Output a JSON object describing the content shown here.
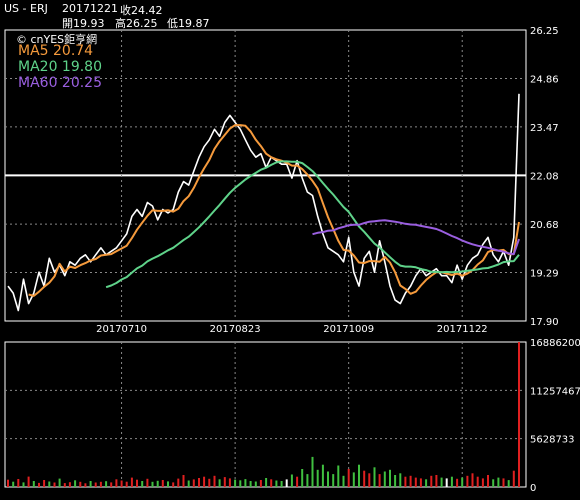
{
  "header": {
    "symbol": "US - ERJ",
    "date": "20171221",
    "close": "收24.42",
    "open": "開19.93",
    "high": "高26.25",
    "low": "低19.87"
  },
  "watermark": "© cnYES鉅亨網",
  "legend": [
    {
      "label": "MA5 20.74",
      "color": "#f59a3c"
    },
    {
      "label": "MA20 19.80",
      "color": "#5fd38a"
    },
    {
      "label": "MA60 20.25",
      "color": "#9a5fe0"
    }
  ],
  "colors": {
    "background": "#000000",
    "price": "#ffffff",
    "ma5": "#f59a3c",
    "ma20": "#5fd38a",
    "ma60": "#9a5fe0",
    "vol_up": "#e02020",
    "vol_down": "#40c040",
    "vol_flat": "#ffffff"
  },
  "chart_data": [
    {
      "type": "line",
      "x_ticks": [
        "20170710",
        "20170823",
        "20171009",
        "20171122"
      ],
      "y_ticks": [
        "26.25",
        "24.86",
        "23.47",
        "22.08",
        "20.68",
        "19.29",
        "17.90"
      ],
      "ylim": [
        17.9,
        26.25
      ],
      "reference_line": 22.08,
      "grid": true,
      "series": [
        {
          "name": "Price",
          "values": [
            18.9,
            18.7,
            18.2,
            19.1,
            18.4,
            18.7,
            19.3,
            18.9,
            19.7,
            19.3,
            19.5,
            19.2,
            19.6,
            19.5,
            19.7,
            19.8,
            19.6,
            19.8,
            20.0,
            19.8,
            19.9,
            20.0,
            20.2,
            20.4,
            20.9,
            21.1,
            20.9,
            21.3,
            21.2,
            20.8,
            21.1,
            21.0,
            21.1,
            21.6,
            21.9,
            21.8,
            22.2,
            22.6,
            22.9,
            23.1,
            23.4,
            23.2,
            23.6,
            23.8,
            23.6,
            23.4,
            23.1,
            22.8,
            22.6,
            22.7,
            22.3,
            22.6,
            22.5,
            22.4,
            22.4,
            22.0,
            22.5,
            22.0,
            21.6,
            21.5,
            20.9,
            20.4,
            20.0,
            19.9,
            19.8,
            19.6,
            20.3,
            19.3,
            18.9,
            19.7,
            19.9,
            19.3,
            20.2,
            19.6,
            18.9,
            18.5,
            18.4,
            18.7,
            18.9,
            19.2,
            19.4,
            19.2,
            19.3,
            19.4,
            19.2,
            19.2,
            19.0,
            19.5,
            19.1,
            19.5,
            19.7,
            19.8,
            20.1,
            20.3,
            19.8,
            19.6,
            19.9,
            19.5,
            20.3,
            24.42
          ]
        },
        {
          "name": "MA5",
          "values": [
            null,
            null,
            null,
            null,
            18.66,
            18.62,
            18.74,
            18.88,
            19.0,
            19.18,
            19.54,
            19.32,
            19.46,
            19.42,
            19.5,
            19.56,
            19.64,
            19.68,
            19.78,
            19.8,
            19.82,
            19.9,
            19.98,
            20.06,
            20.28,
            20.52,
            20.72,
            20.92,
            21.08,
            21.06,
            21.06,
            21.08,
            21.04,
            21.12,
            21.34,
            21.48,
            21.72,
            22.02,
            22.28,
            22.52,
            22.84,
            23.06,
            23.24,
            23.42,
            23.52,
            23.52,
            23.5,
            23.34,
            23.1,
            22.92,
            22.7,
            22.6,
            22.54,
            22.5,
            22.44,
            22.36,
            22.36,
            22.26,
            22.1,
            21.92,
            21.7,
            21.28,
            20.88,
            20.54,
            20.2,
            19.94,
            19.92,
            19.78,
            19.58,
            19.56,
            19.62,
            19.62,
            19.6,
            19.74,
            19.58,
            19.3,
            18.92,
            18.82,
            18.68,
            18.74,
            18.92,
            19.08,
            19.2,
            19.3,
            19.3,
            19.26,
            19.22,
            19.26,
            19.2,
            19.26,
            19.36,
            19.52,
            19.64,
            19.88,
            19.94,
            19.92,
            19.94,
            19.82,
            19.82,
            20.74
          ]
        },
        {
          "name": "MA20",
          "values": [
            null,
            null,
            null,
            null,
            null,
            null,
            null,
            null,
            null,
            null,
            null,
            null,
            null,
            null,
            null,
            null,
            null,
            null,
            null,
            18.87,
            18.92,
            18.99,
            19.09,
            19.16,
            19.29,
            19.41,
            19.49,
            19.61,
            19.69,
            19.76,
            19.84,
            19.93,
            20.0,
            20.11,
            20.22,
            20.32,
            20.45,
            20.59,
            20.74,
            20.9,
            21.07,
            21.23,
            21.41,
            21.58,
            21.72,
            21.84,
            21.96,
            22.06,
            22.15,
            22.24,
            22.3,
            22.38,
            22.45,
            22.48,
            22.48,
            22.47,
            22.47,
            22.43,
            22.32,
            22.2,
            22.04,
            21.86,
            21.69,
            21.53,
            21.35,
            21.17,
            21.03,
            20.82,
            20.61,
            20.46,
            20.29,
            20.12,
            20.01,
            19.87,
            19.73,
            19.6,
            19.49,
            19.46,
            19.46,
            19.44,
            19.39,
            19.36,
            19.31,
            19.31,
            19.3,
            19.31,
            19.3,
            19.31,
            19.32,
            19.34,
            19.36,
            19.38,
            19.41,
            19.42,
            19.47,
            19.52,
            19.59,
            19.61,
            19.62,
            19.8
          ]
        },
        {
          "name": "MA60",
          "values": [
            null,
            null,
            null,
            null,
            null,
            null,
            null,
            null,
            null,
            null,
            null,
            null,
            null,
            null,
            null,
            null,
            null,
            null,
            null,
            null,
            null,
            null,
            null,
            null,
            null,
            null,
            null,
            null,
            null,
            null,
            null,
            null,
            null,
            null,
            null,
            null,
            null,
            null,
            null,
            null,
            null,
            null,
            null,
            null,
            null,
            null,
            null,
            null,
            null,
            null,
            null,
            null,
            null,
            null,
            null,
            null,
            null,
            null,
            null,
            20.39,
            20.43,
            20.45,
            20.49,
            20.5,
            20.56,
            20.6,
            20.65,
            20.66,
            20.66,
            20.71,
            20.75,
            20.76,
            20.78,
            20.79,
            20.77,
            20.75,
            20.72,
            20.69,
            20.67,
            20.66,
            20.63,
            20.6,
            20.57,
            20.54,
            20.48,
            20.41,
            20.34,
            20.28,
            20.21,
            20.15,
            20.1,
            20.06,
            20.03,
            20.0,
            19.96,
            19.92,
            19.89,
            19.84,
            19.82,
            20.25
          ]
        }
      ]
    },
    {
      "type": "bar",
      "y_ticks": [
        "16886200",
        "11257467",
        "5628733",
        "0"
      ],
      "ylim": [
        0,
        16886200
      ],
      "values": [
        850000,
        620000,
        930000,
        540000,
        1210000,
        700000,
        480000,
        820000,
        640000,
        520000,
        980000,
        450000,
        560000,
        780000,
        600000,
        430000,
        700000,
        520000,
        610000,
        680000,
        540000,
        900000,
        760000,
        620000,
        1100000,
        850000,
        700000,
        950000,
        600000,
        720000,
        820000,
        650000,
        540000,
        980000,
        1400000,
        760000,
        880000,
        1050000,
        1200000,
        950000,
        1300000,
        900000,
        1150000,
        1000000,
        860000,
        780000,
        920000,
        700000,
        640000,
        820000,
        1050000,
        900000,
        760000,
        700000,
        880000,
        1450000,
        1200000,
        2100000,
        1500000,
        3500000,
        2000000,
        2600000,
        1800000,
        1500000,
        2500000,
        1300000,
        2100000,
        1700000,
        2600000,
        1900000,
        1600000,
        2300000,
        1500000,
        1800000,
        2000000,
        1400000,
        1600000,
        1200000,
        1300000,
        1100000,
        1000000,
        900000,
        1300000,
        1400000,
        1100000,
        1000000,
        1200000,
        950000,
        1100000,
        1300000,
        1600000,
        1200000,
        1000000,
        1400000,
        900000,
        1100000,
        1000000,
        800000,
        1900000,
        16886200
      ],
      "direction": [
        "u",
        "d",
        "u",
        "d",
        "u",
        "d",
        "u",
        "u",
        "d",
        "u",
        "d",
        "u",
        "u",
        "d",
        "u",
        "u",
        "d",
        "u",
        "u",
        "d",
        "u",
        "u",
        "u",
        "u",
        "u",
        "u",
        "d",
        "u",
        "d",
        "d",
        "u",
        "d",
        "u",
        "u",
        "u",
        "d",
        "u",
        "u",
        "u",
        "u",
        "u",
        "d",
        "u",
        "u",
        "d",
        "d",
        "d",
        "d",
        "d",
        "u",
        "d",
        "u",
        "d",
        "d",
        "f",
        "d",
        "u",
        "d",
        "d",
        "d",
        "d",
        "d",
        "d",
        "d",
        "d",
        "d",
        "u",
        "d",
        "d",
        "u",
        "u",
        "d",
        "u",
        "d",
        "d",
        "d",
        "d",
        "u",
        "u",
        "u",
        "u",
        "d",
        "u",
        "u",
        "d",
        "f",
        "d",
        "u",
        "d",
        "u",
        "u",
        "u",
        "u",
        "u",
        "d",
        "d",
        "u",
        "d",
        "u",
        "u"
      ]
    }
  ]
}
